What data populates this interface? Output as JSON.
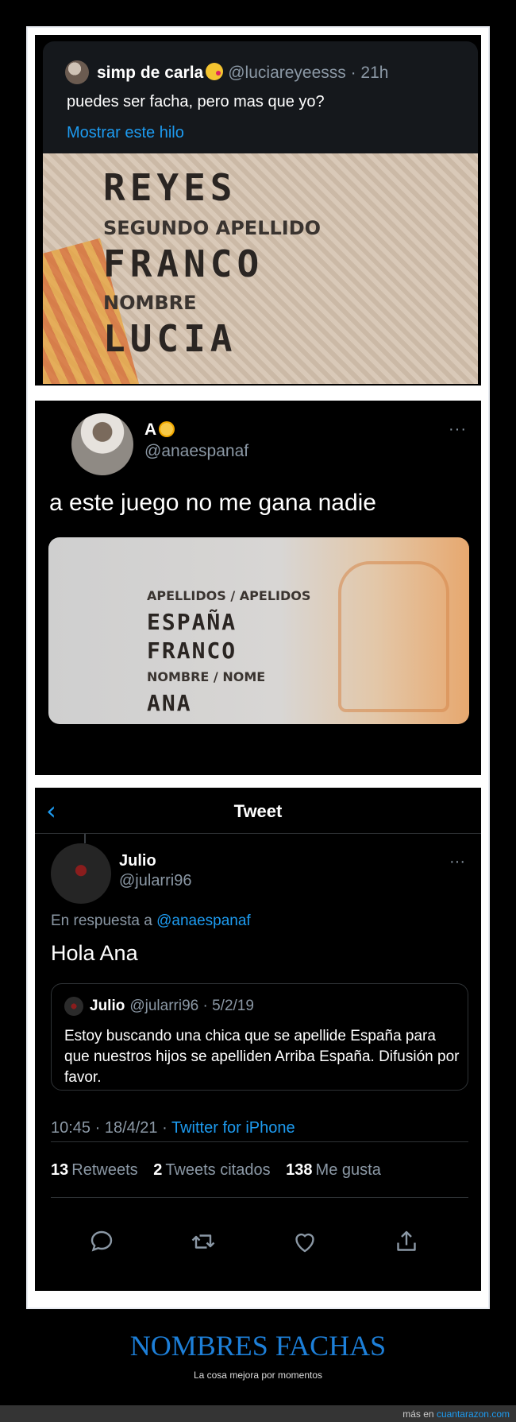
{
  "panel1": {
    "name": "simp de carla",
    "handle": "@luciareyeesss · 21h",
    "text": "puedes ser facha, pero mas que yo?",
    "thread_link": "Mostrar este hilo",
    "id_card": {
      "label1": "SEGUNDO APELLIDO",
      "label2": "NOMBRE",
      "surname1": "REYES",
      "surname2": "FRANCO",
      "name": "LUCIA"
    }
  },
  "panel2": {
    "name": "A",
    "handle": "@anaespanaf",
    "more": "···",
    "text": "a este juego no me gana nadie",
    "id_card": {
      "label1": "APELLIDOS / APELIDOS",
      "surname1": "ESPAÑA",
      "surname2": "FRANCO",
      "label2": "NOMBRE / NOME",
      "name": "ANA"
    }
  },
  "panel3": {
    "back": "‹",
    "title": "Tweet",
    "name": "Julio",
    "handle": "@jularri96",
    "more": "···",
    "reply_prefix": "En respuesta a",
    "reply_to": "@anaespanaf",
    "text": "Hola Ana",
    "quote": {
      "name": "Julio",
      "handle": "@jularri96 · 5/2/19",
      "text": "Estoy buscando una chica que se apellide España para que nuestros hijos se apelliden Arriba España. Difusión por favor."
    },
    "time": "10:45 · 18/4/21 ·",
    "source": "Twitter for iPhone",
    "stats": {
      "retweets_count": "13",
      "retweets_label": "Retweets",
      "quotes_count": "2",
      "quotes_label": "Tweets citados",
      "likes_count": "138",
      "likes_label": "Me gusta"
    },
    "actions": [
      "reply-icon",
      "retweet-icon",
      "like-icon",
      "share-icon"
    ]
  },
  "caption": {
    "title": "NOMBRES FACHAS",
    "subtitle": "La cosa mejora por momentos"
  },
  "footer": {
    "prefix": "más en",
    "site": "cuantarazon.com"
  },
  "colors": {
    "accent": "#1d9bf0",
    "muted": "#8b98a5",
    "caption": "#1d7fd8"
  }
}
